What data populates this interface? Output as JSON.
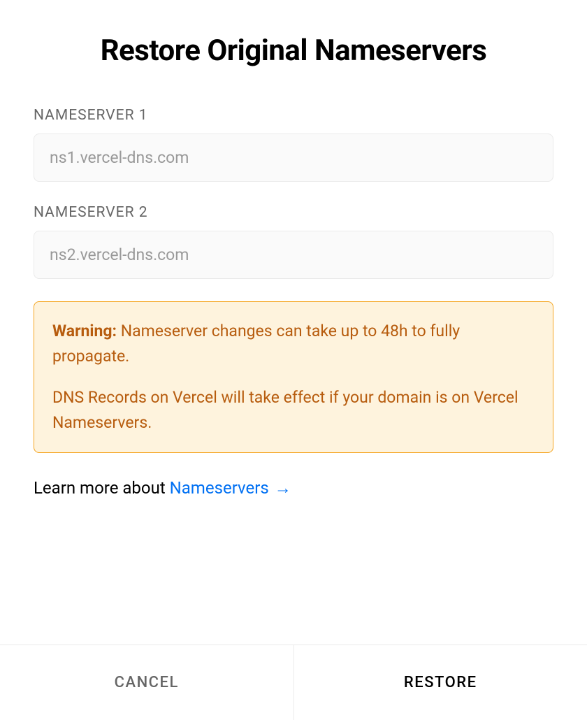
{
  "dialog": {
    "title": "Restore Original Nameservers"
  },
  "fields": {
    "nameserver1": {
      "label": "NAMESERVER 1",
      "value": "ns1.vercel-dns.com"
    },
    "nameserver2": {
      "label": "NAMESERVER 2",
      "value": "ns2.vercel-dns.com"
    }
  },
  "warning": {
    "label": "Warning:",
    "line1": " Nameserver changes can take up to 48h to fully propagate.",
    "line2": "DNS Records on Vercel will take effect if your domain is on Vercel Nameservers."
  },
  "learnMore": {
    "prefix": "Learn more about ",
    "linkText": "Nameservers",
    "arrow": "→"
  },
  "footer": {
    "cancel": "CANCEL",
    "restore": "RESTORE"
  }
}
